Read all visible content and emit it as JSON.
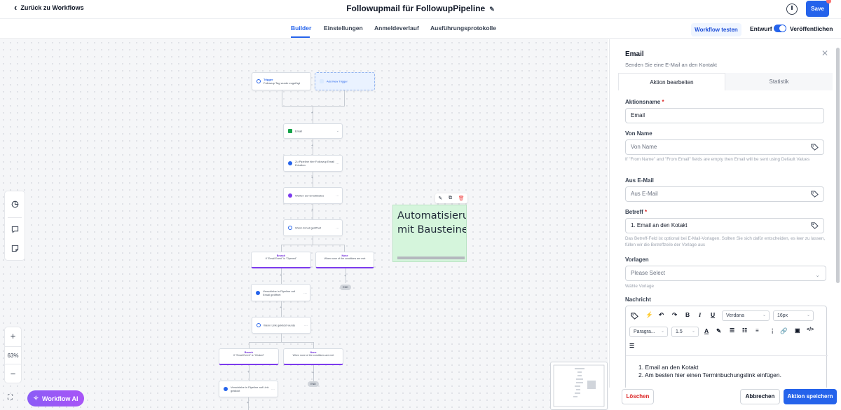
{
  "header": {
    "back_label": "Zurück zu Workflows",
    "title": "Followupmail für FollowupPipeline",
    "save_label": "Save"
  },
  "tabs": [
    "Builder",
    "Einstellungen",
    "Anmeldeverlauf",
    "Ausführungsprotokolle"
  ],
  "actions": {
    "test_label": "Workflow testen",
    "draft_label": "Entwurf",
    "published_label": "Veröffentlichen",
    "published": true
  },
  "canvas": {
    "trigger": {
      "title": "Trigger",
      "subtitle": "Followup Tag wurde zugefügt"
    },
    "add_trigger": "Add New Trigger",
    "steps": {
      "email": "Email",
      "pipeline1": "Zu Pipeline hier Followup Email Erhalten",
      "wait": "Warten auf Emailstatus",
      "if_opened": "Wenn Email geöffnet",
      "pipeline2": "Verschiebe in Pipeline auf Email geöffnet",
      "if_link": "Wenn Link geklickt wurde",
      "pipeline3": "Verschiebe in Pipeline auf Link geklickt"
    },
    "branches": {
      "branch_label": "Branch",
      "none_label": "None",
      "branch1_condition": "If \"Email Event\" is \"Opened\"",
      "branch2_condition": "If \"Email Event\" is \"Clicked\"",
      "none_condition": "When none of the conditions are met"
    },
    "end_label": "END",
    "note_text": "Automatisierung mit Bausteinen",
    "zoom_level": "63%",
    "ai_button": "Workflow AI"
  },
  "panel": {
    "title": "Email",
    "subtitle": "Senden Sie eine E-Mail an den Kontakt",
    "tab_edit": "Aktion bearbeiten",
    "tab_stats": "Statistik",
    "action_name_label": "Aktionsname",
    "action_name_value": "Email",
    "from_name_label": "Von Name",
    "from_name_placeholder": "Von Name",
    "from_hint": "If \"From Name\" and \"From Email\" fields are empty then Email will be sent using Default Values",
    "from_email_label": "Aus E-Mail",
    "from_email_placeholder": "Aus E-Mail",
    "subject_label": "Betreff",
    "subject_value": "1. Email an den Kotakt",
    "subject_hint": "Das Betreff-Feld ist optional bei E-Mail-Vorlagen. Sollten Sie sich dafür entscheiden, es leer zu lassen, füllen wir die Betreffzeile der Vorlage aus",
    "templates_label": "Vorlagen",
    "templates_placeholder": "Please Select",
    "templates_hint": "Wähle Vorlage",
    "message_label": "Nachricht",
    "editor": {
      "font": "Verdana",
      "size": "16px",
      "paragraph": "Paragra...",
      "line_height": "1.5",
      "lines": [
        "Email an den Kotakt",
        "Am besten hier einen Terminbuchungslink einfügen."
      ]
    },
    "delete_label": "Löschen",
    "cancel_label": "Abbrechen",
    "save_label": "Aktion speichern"
  }
}
